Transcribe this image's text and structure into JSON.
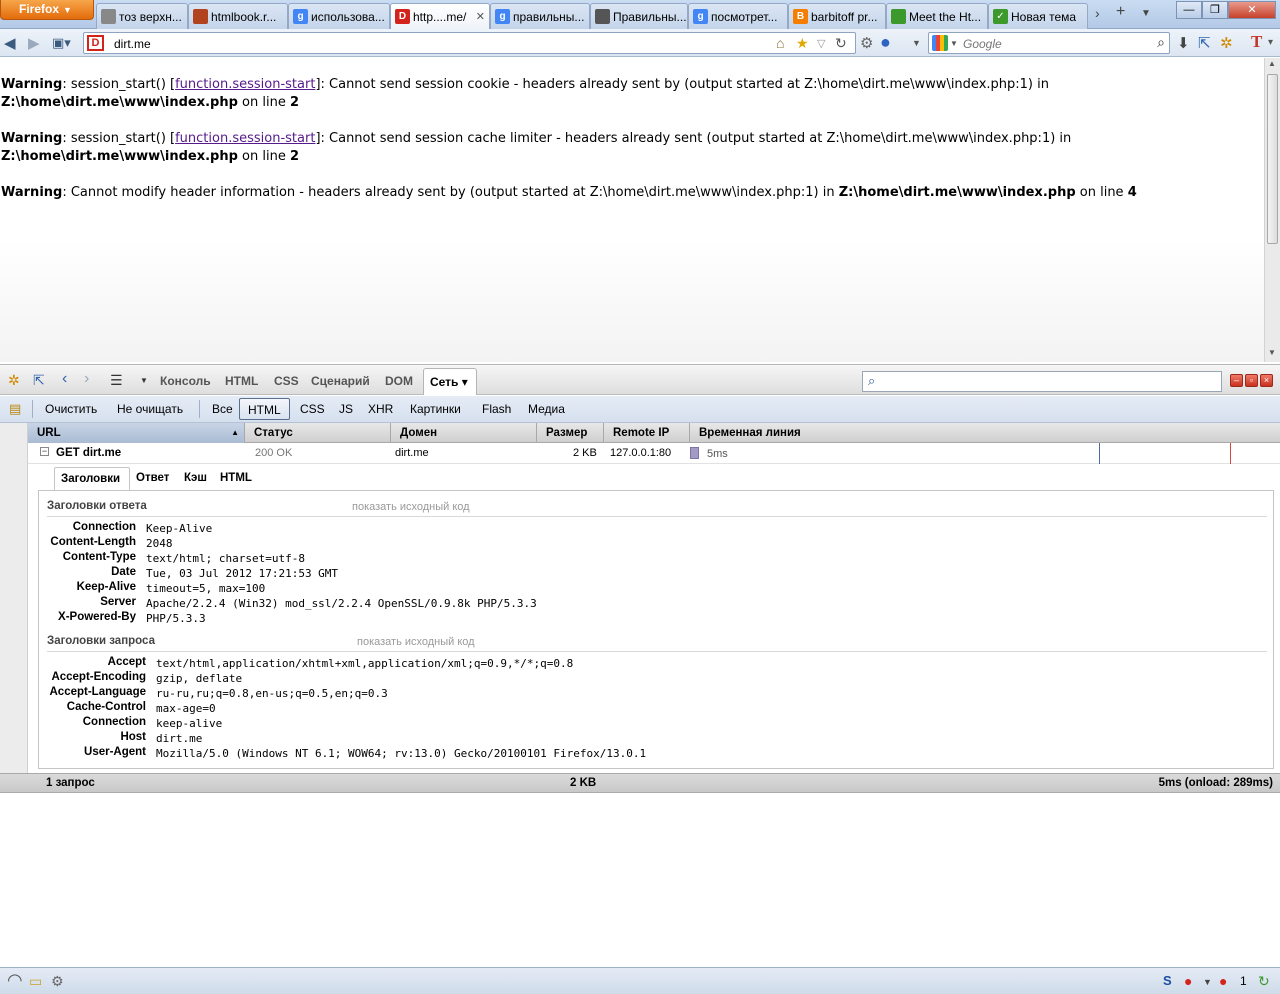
{
  "browser": {
    "menu_button": "Firefox",
    "tabs": [
      {
        "label": "тоз верхн...",
        "favicon_color": "#888888",
        "favicon_text": ""
      },
      {
        "label": "htmlbook.r...",
        "favicon_color": "#b2431f",
        "favicon_text": ""
      },
      {
        "label": "использова...",
        "favicon_color": "#4285f4",
        "favicon_text": "g"
      },
      {
        "label": "http....me/",
        "favicon_color": "#d2241a",
        "favicon_text": "D"
      },
      {
        "label": "правильны...",
        "favicon_color": "#4285f4",
        "favicon_text": "g"
      },
      {
        "label": "Правильны...",
        "favicon_color": "#555555",
        "favicon_text": ""
      },
      {
        "label": "посмотрет...",
        "favicon_color": "#4285f4",
        "favicon_text": "g"
      },
      {
        "label": "barbitoff pr...",
        "favicon_color": "#f57d00",
        "favicon_text": "B"
      },
      {
        "label": "Meet the Ht...",
        "favicon_color": "#3c9a2c",
        "favicon_text": ""
      },
      {
        "label": "Новая тема",
        "favicon_color": "#3c9a2c",
        "favicon_text": "✓"
      }
    ],
    "active_tab_index": 3,
    "url": "dirt.me",
    "search_placeholder": "Google"
  },
  "page": {
    "warnings": [
      {
        "label": "Warning",
        "pre": ": session_start() [",
        "link": "function.session-start",
        "post": "]: Cannot send session cookie - headers already sent by (output started at Z:\\home\\dirt.me\\www\\index.php:1) in ",
        "path": "Z:\\home\\dirt.me\\www\\index.php",
        "online": " on line ",
        "line": "2"
      },
      {
        "label": "Warning",
        "pre": ": session_start() [",
        "link": "function.session-start",
        "post": "]: Cannot send session cache limiter - headers already sent (output started at Z:\\home\\dirt.me\\www\\index.php:1) in ",
        "path": "Z:\\home\\dirt.me\\www\\index.php",
        "online": " on line ",
        "line": "2"
      },
      {
        "label": "Warning",
        "pre": ": Cannot modify header information - headers already sent by (output started at Z:\\home\\dirt.me\\www\\index.php:1) in ",
        "link": "",
        "post": "",
        "path": "Z:\\home\\dirt.me\\www\\index.php",
        "online": " on line ",
        "line": "4"
      }
    ]
  },
  "firebug": {
    "tabs": [
      "Консоль",
      "HTML",
      "CSS",
      "Сценарий",
      "DOM",
      "Сеть ▾"
    ],
    "selected_tab": "Сеть ▾",
    "net_toolbar": {
      "clear": "Очистить",
      "persist": "Не очищать",
      "filters": [
        "Все",
        "HTML",
        "CSS",
        "JS",
        "XHR",
        "Картинки",
        "Flash",
        "Медиа"
      ],
      "selected_filter": "HTML"
    },
    "columns": [
      "URL",
      "Статус",
      "Домен",
      "Размер",
      "Remote IP",
      "Временная линия"
    ],
    "request": {
      "url": "GET dirt.me",
      "status": "200 OK",
      "domain": "dirt.me",
      "size": "2 KB",
      "remote_ip": "127.0.0.1:80",
      "timeline": "5ms"
    },
    "detail_tabs": [
      "Заголовки",
      "Ответ",
      "Кэш",
      "HTML"
    ],
    "selected_detail_tab": "Заголовки",
    "response_headers_title": "Заголовки ответа",
    "request_headers_title": "Заголовки запроса",
    "view_source": "показать исходный код",
    "response_headers": [
      {
        "name": "Connection",
        "value": "Keep-Alive"
      },
      {
        "name": "Content-Length",
        "value": "2048"
      },
      {
        "name": "Content-Type",
        "value": "text/html; charset=utf-8"
      },
      {
        "name": "Date",
        "value": "Tue, 03 Jul 2012 17:21:53 GMT"
      },
      {
        "name": "Keep-Alive",
        "value": "timeout=5, max=100"
      },
      {
        "name": "Server",
        "value": "Apache/2.2.4 (Win32) mod_ssl/2.2.4 OpenSSL/0.9.8k PHP/5.3.3"
      },
      {
        "name": "X-Powered-By",
        "value": "PHP/5.3.3"
      }
    ],
    "request_headers": [
      {
        "name": "Accept",
        "value": "text/html,application/xhtml+xml,application/xml;q=0.9,*/*;q=0.8"
      },
      {
        "name": "Accept-Encoding",
        "value": "gzip, deflate"
      },
      {
        "name": "Accept-Language",
        "value": "ru-ru,ru;q=0.8,en-us;q=0.5,en;q=0.3"
      },
      {
        "name": "Cache-Control",
        "value": "max-age=0"
      },
      {
        "name": "Connection",
        "value": "keep-alive"
      },
      {
        "name": "Host",
        "value": "dirt.me"
      },
      {
        "name": "User-Agent",
        "value": "Mozilla/5.0 (Windows NT 6.1; WOW64; rv:13.0) Gecko/20100101 Firefox/13.0.1"
      }
    ],
    "summary": {
      "requests": "1 запрос",
      "size": "2 KB",
      "time": "5ms (onload: 289ms)"
    }
  },
  "statusbar": {
    "counter": "1"
  }
}
